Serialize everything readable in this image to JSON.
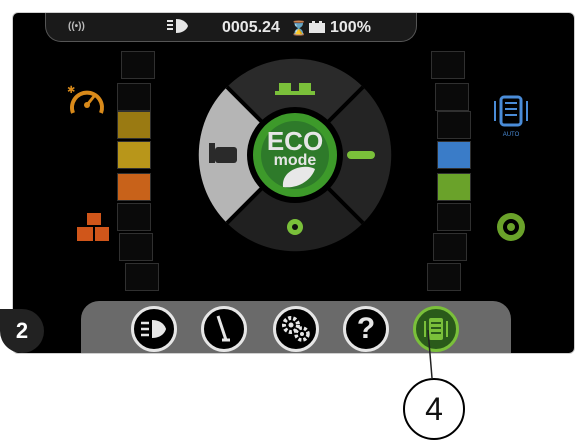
{
  "status_bar": {
    "signal_icon": "signal-icon",
    "headlight_icon": "headlight-icon",
    "hour_meter": "0005.24",
    "hourglass_icon": "hourglass-icon",
    "battery_icon": "battery-icon",
    "battery_percent": "100%"
  },
  "center": {
    "eco_line1": "ECO",
    "eco_line2": "mode",
    "auto_label": "AUTO"
  },
  "bottom_buttons": [
    "headlight-button",
    "wiper-button",
    "settings-button",
    "help-button",
    "auto-brake-button"
  ],
  "callouts": {
    "left": "2",
    "right": "4"
  },
  "colors": {
    "accent_green": "#7ac03a",
    "eco_dark_green": "#2e7a2a",
    "orange": "#c8621a",
    "yellow": "#c9a21a",
    "blue": "#3a7cc8"
  }
}
